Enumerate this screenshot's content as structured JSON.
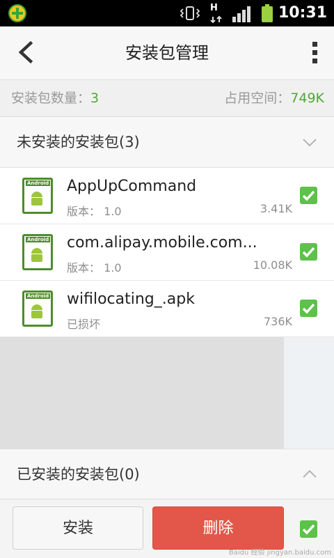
{
  "status_bar": {
    "time": "10:31",
    "icons": [
      "app-360-icon",
      "vibrate-icon",
      "hspa-data-icon",
      "signal-icon",
      "battery-icon"
    ],
    "h_label": "H"
  },
  "header": {
    "title": "安装包管理",
    "back_icon": "back-chevron-icon",
    "menu_icon": "more-vertical-icon"
  },
  "summary": {
    "count_label": "安装包数量：",
    "count_value": "3",
    "space_label": "占用空间：",
    "space_value": "749K"
  },
  "sections": {
    "not_installed": {
      "label": "未安装的安装包(3)",
      "expanded": true
    },
    "installed": {
      "label": "已安装的安装包(0)",
      "expanded": false
    }
  },
  "packages": [
    {
      "name": "AppUpCommand",
      "sub": "版本： 1.0",
      "size": "3.41K",
      "checked": true,
      "icon_label": "Android"
    },
    {
      "name": "com.alipay.mobile.com...",
      "sub": "版本： 1.0",
      "size": "10.08K",
      "checked": true,
      "icon_label": "Android"
    },
    {
      "name": "wifilocating_.apk",
      "sub": "已损坏",
      "size": "736K",
      "checked": true,
      "icon_label": "Android"
    }
  ],
  "actions": {
    "install_label": "安装",
    "delete_label": "删除",
    "select_all_checked": true
  },
  "watermark": "Baidu 经验 jingyan.baidu.com",
  "colors": {
    "accent_green": "#4fa832",
    "delete_red": "#e2574a",
    "checkbox_green": "#5dc14a"
  }
}
